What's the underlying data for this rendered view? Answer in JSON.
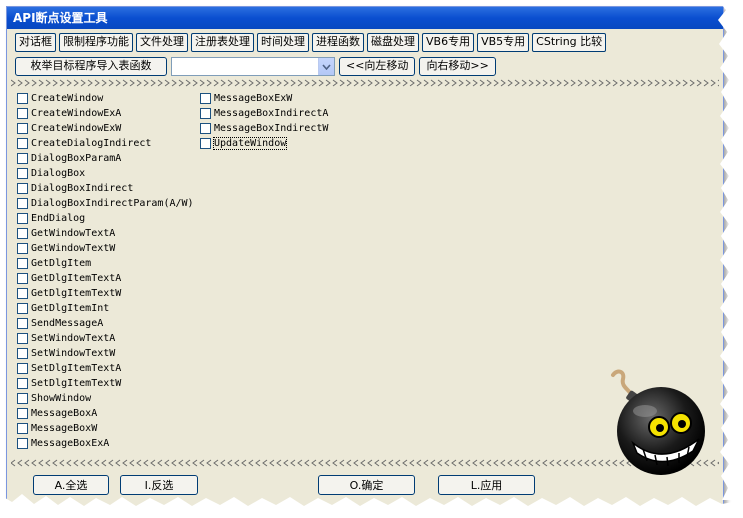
{
  "window": {
    "title": "API断点设置工具"
  },
  "tabs": [
    "对话框",
    "限制程序功能",
    "文件处理",
    "注册表处理",
    "时间处理",
    "进程函数",
    "磁盘处理",
    "VB6专用",
    "VB5专用",
    "CString 比较"
  ],
  "toolbar": {
    "enumerate_label": "枚举目标程序导入表函数",
    "combo_value": "",
    "move_left_label": "<<向左移动",
    "move_right_label": "向右移动>>"
  },
  "column1": [
    "CreateWindow",
    "CreateWindowExA",
    "CreateWindowExW",
    "CreateDialogIndirect",
    "DialogBoxParamA",
    "DialogBox",
    "DialogBoxIndirect",
    "DialogBoxIndirectParam(A/W)",
    "EndDialog",
    "GetWindowTextA",
    "GetWindowTextW",
    "GetDlgItem",
    "GetDlgItemTextA",
    "GetDlgItemTextW",
    "GetDlgItemInt",
    "SendMessageA",
    "SetWindowTextA",
    "SetWindowTextW",
    "SetDlgItemTextA",
    "SetDlgItemTextW",
    "ShowWindow",
    "MessageBoxA",
    "MessageBoxW",
    "MessageBoxExA"
  ],
  "column2": [
    "MessageBoxExW",
    "MessageBoxIndirectA",
    "MessageBoxIndirectW",
    "UpdateWindow"
  ],
  "footer": {
    "select_all": "A.全选",
    "invert": "I.反选",
    "ok": "O.确定",
    "apply": "L.应用"
  },
  "colors": {
    "title_bar": "#0a4ed0",
    "dialog_bg": "#ece9d8",
    "button_border": "#003c74"
  }
}
